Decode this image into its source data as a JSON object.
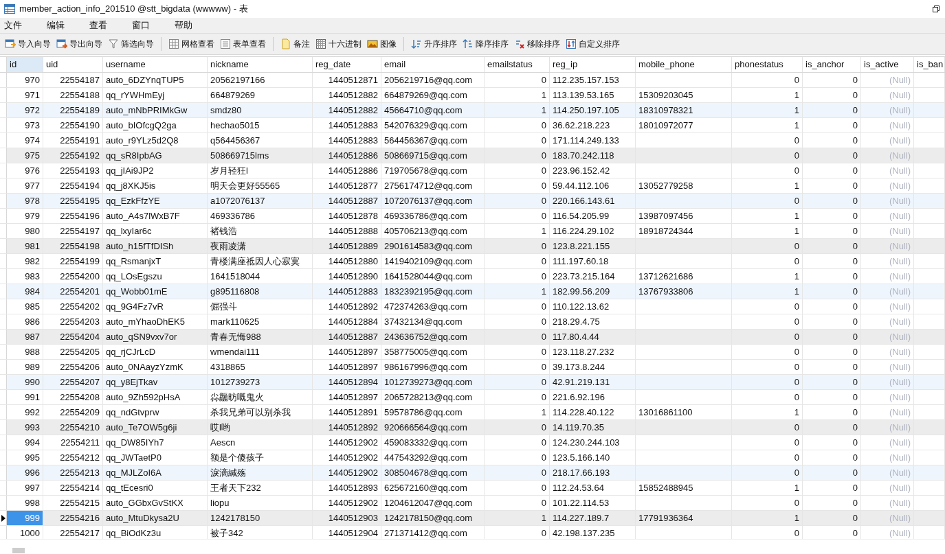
{
  "window": {
    "title": "member_action_info_201510 @stt_bigdata (wwwww) - 表"
  },
  "menu": [
    "文件",
    "编辑",
    "查看",
    "窗口",
    "帮助"
  ],
  "toolbar": [
    [
      "导入向导",
      "导出向导",
      "筛选向导"
    ],
    [
      "网格查看",
      "表单查看"
    ],
    [
      "备注",
      "十六进制",
      "图像"
    ],
    [
      "升序排序",
      "降序排序",
      "移除排序",
      "自定义排序"
    ]
  ],
  "table": {
    "columns": [
      {
        "label": "id",
        "kind": "number",
        "selected": true
      },
      {
        "label": "uid",
        "kind": "number",
        "selected": false
      },
      {
        "label": "username",
        "kind": "text",
        "selected": false
      },
      {
        "label": "nickname",
        "kind": "text",
        "selected": false
      },
      {
        "label": "reg_date",
        "kind": "number",
        "selected": false
      },
      {
        "label": "email",
        "kind": "text",
        "selected": false
      },
      {
        "label": "emailstatus",
        "kind": "number",
        "selected": false
      },
      {
        "label": "reg_ip",
        "kind": "text",
        "selected": false
      },
      {
        "label": "mobile_phone",
        "kind": "text",
        "selected": false
      },
      {
        "label": "phonestatus",
        "kind": "number",
        "selected": false
      },
      {
        "label": "is_anchor",
        "kind": "number",
        "selected": false
      },
      {
        "label": "is_active",
        "kind": "null",
        "selected": false
      },
      {
        "label": "is_ban",
        "selected": false
      }
    ],
    "rows": [
      {
        "selected": false,
        "kind": "plain",
        "cells": [
          "970",
          "22554187",
          "auto_6DZYnqTUP5",
          "20562197166",
          "1440512871",
          "2056219716@qq.com",
          "0",
          "112.235.157.153",
          null,
          "0",
          "0",
          "(Null)"
        ]
      },
      {
        "selected": false,
        "kind": "plain",
        "cells": [
          "971",
          "22554188",
          "qq_rYWHmEyj",
          "664879269",
          "1440512882",
          "664879269@qq.com",
          "1",
          "113.139.53.165",
          "15309203045",
          "1",
          "0",
          "(Null)"
        ]
      },
      {
        "selected": false,
        "kind": "blue",
        "cells": [
          "972",
          "22554189",
          "auto_mNbPRIMkGw",
          "smdz80",
          "1440512882",
          "45664710@qq.com",
          "1",
          "114.250.197.105",
          "18310978321",
          "1",
          "0",
          "(Null)"
        ]
      },
      {
        "selected": false,
        "kind": "plain",
        "cells": [
          "973",
          "22554190",
          "auto_bIOfcgQ2ga",
          "hechao5015",
          "1440512883",
          "542076329@qq.com",
          "0",
          "36.62.218.223",
          "18010972077",
          "1",
          "0",
          "(Null)"
        ]
      },
      {
        "selected": false,
        "kind": "plain",
        "cells": [
          "974",
          "22554191",
          "auto_r9YLz5d2Q8",
          "q564456367",
          "1440512883",
          "564456367@qq.com",
          "0",
          "171.114.249.133",
          null,
          "0",
          "0",
          "(Null)"
        ]
      },
      {
        "selected": false,
        "kind": "gray",
        "cells": [
          "975",
          "22554192",
          "qq_sR8IpbAG",
          "508669715lms",
          "1440512886",
          "508669715@qq.com",
          "0",
          "183.70.242.118",
          null,
          "0",
          "0",
          "(Null)"
        ]
      },
      {
        "selected": false,
        "kind": "plain",
        "cells": [
          "976",
          "22554193",
          "qq_jIAi9JP2",
          "岁月轻狂l",
          "1440512886",
          "719705678@qq.com",
          "0",
          "223.96.152.42",
          null,
          "0",
          "0",
          "(Null)"
        ]
      },
      {
        "selected": false,
        "kind": "plain",
        "cells": [
          "977",
          "22554194",
          "qq_j8XKJ5is",
          "明天会更好55565",
          "1440512877",
          "2756174712@qq.com",
          "0",
          "59.44.112.106",
          "13052779258",
          "1",
          "0",
          "(Null)"
        ]
      },
      {
        "selected": false,
        "kind": "blue",
        "cells": [
          "978",
          "22554195",
          "qq_EzkFfzYE",
          "a1072076137",
          "1440512887",
          "1072076137@qq.com",
          "0",
          "220.166.143.61",
          null,
          "0",
          "0",
          "(Null)"
        ]
      },
      {
        "selected": false,
        "kind": "plain",
        "cells": [
          "979",
          "22554196",
          "auto_A4s7lWxB7F",
          "469336786",
          "1440512878",
          "469336786@qq.com",
          "0",
          "116.54.205.99",
          "13987097456",
          "1",
          "0",
          "(Null)"
        ]
      },
      {
        "selected": false,
        "kind": "plain",
        "cells": [
          "980",
          "22554197",
          "qq_lxyIar6c",
          "褚钱浩",
          "1440512888",
          "405706213@qq.com",
          "1",
          "116.224.29.102",
          "18918724344",
          "1",
          "0",
          "(Null)"
        ]
      },
      {
        "selected": false,
        "kind": "gray",
        "cells": [
          "981",
          "22554198",
          "auto_h15fTfDISh",
          "夜雨凌潇",
          "1440512889",
          "2901614583@qq.com",
          "0",
          "123.8.221.155",
          null,
          "0",
          "0",
          "(Null)"
        ]
      },
      {
        "selected": false,
        "kind": "plain",
        "cells": [
          "982",
          "22554199",
          "qq_RsmanjxT",
          "青楼满座祗因人心寂寞",
          "1440512880",
          "1419402109@qq.com",
          "0",
          "111.197.60.18",
          null,
          "0",
          "0",
          "(Null)"
        ]
      },
      {
        "selected": false,
        "kind": "plain",
        "cells": [
          "983",
          "22554200",
          "qq_LOsEgszu",
          "1641518044",
          "1440512890",
          "1641528044@qq.com",
          "0",
          "223.73.215.164",
          "13712621686",
          "1",
          "0",
          "(Null)"
        ]
      },
      {
        "selected": false,
        "kind": "blue",
        "cells": [
          "984",
          "22554201",
          "qq_Wobb01mE",
          "g895116808",
          "1440512883",
          "1832392195@qq.com",
          "1",
          "182.99.56.209",
          "13767933806",
          "1",
          "0",
          "(Null)"
        ]
      },
      {
        "selected": false,
        "kind": "plain",
        "cells": [
          "985",
          "22554202",
          "qq_9G4Fz7vR",
          "倔强斗",
          "1440512892",
          "472374263@qq.com",
          "0",
          "110.122.13.62",
          null,
          "0",
          "0",
          "(Null)"
        ]
      },
      {
        "selected": false,
        "kind": "plain",
        "cells": [
          "986",
          "22554203",
          "auto_mYhaoDhEK5",
          "mark110625",
          "1440512884",
          "37432134@qq.com",
          "0",
          "218.29.4.75",
          null,
          "0",
          "0",
          "(Null)"
        ]
      },
      {
        "selected": false,
        "kind": "gray",
        "cells": [
          "987",
          "22554204",
          "auto_qSN9vxv7or",
          "青春无悔988",
          "1440512887",
          "243636752@qq.com",
          "0",
          "117.80.4.44",
          null,
          "0",
          "0",
          "(Null)"
        ]
      },
      {
        "selected": false,
        "kind": "plain",
        "cells": [
          "988",
          "22554205",
          "qq_rjCJrLcD",
          "wmendai111",
          "1440512897",
          "358775005@qq.com",
          "0",
          "123.118.27.232",
          null,
          "0",
          "0",
          "(Null)"
        ]
      },
      {
        "selected": false,
        "kind": "plain",
        "cells": [
          "989",
          "22554206",
          "auto_0NAayzYzmK",
          "4318865",
          "1440512897",
          "986167996@qq.com",
          "0",
          "39.173.8.244",
          null,
          "0",
          "0",
          "(Null)"
        ]
      },
      {
        "selected": false,
        "kind": "blue",
        "cells": [
          "990",
          "22554207",
          "qq_y8EjTkav",
          "1012739273",
          "1440512894",
          "1012739273@qq.com",
          "0",
          "42.91.219.131",
          null,
          "0",
          "0",
          "(Null)"
        ]
      },
      {
        "selected": false,
        "kind": "plain",
        "cells": [
          "991",
          "22554208",
          "auto_9Zh592pHsA",
          "尛龘昉嘅鬼火",
          "1440512897",
          "2065728213@qq.com",
          "0",
          "221.6.92.196",
          null,
          "0",
          "0",
          "(Null)"
        ]
      },
      {
        "selected": false,
        "kind": "plain",
        "cells": [
          "992",
          "22554209",
          "qq_ndGtvprw",
          "杀我兄弟可以别杀我",
          "1440512891",
          "59578786@qq.com",
          "1",
          "114.228.40.122",
          "13016861100",
          "1",
          "0",
          "(Null)"
        ]
      },
      {
        "selected": false,
        "kind": "gray",
        "cells": [
          "993",
          "22554210",
          "auto_Te7OW5g6ji",
          "哎l哟",
          "1440512892",
          "920666564@qq.com",
          "0",
          "14.119.70.35",
          null,
          "0",
          "0",
          "(Null)"
        ]
      },
      {
        "selected": false,
        "kind": "plain",
        "cells": [
          "994",
          "22554211",
          "qq_DW85IYh7",
          "Aescn",
          "1440512902",
          "459083332@qq.com",
          "0",
          "124.230.244.103",
          null,
          "0",
          "0",
          "(Null)"
        ]
      },
      {
        "selected": false,
        "kind": "plain",
        "cells": [
          "995",
          "22554212",
          "qq_JWTaetP0",
          "额是个傻孩子",
          "1440512902",
          "447543292@qq.com",
          "0",
          "123.5.166.140",
          null,
          "0",
          "0",
          "(Null)"
        ]
      },
      {
        "selected": false,
        "kind": "blue",
        "cells": [
          "996",
          "22554213",
          "qq_MJLZoI6A",
          "淚滴緘殇",
          "1440512902",
          "308504678@qq.com",
          "0",
          "218.17.66.193",
          null,
          "0",
          "0",
          "(Null)"
        ]
      },
      {
        "selected": false,
        "kind": "plain",
        "cells": [
          "997",
          "22554214",
          "qq_tEcesri0",
          "王者天下232",
          "1440512893",
          "625672160@qq.com",
          "0",
          "112.24.53.64",
          "15852488945",
          "1",
          "0",
          "(Null)"
        ]
      },
      {
        "selected": false,
        "kind": "plain",
        "cells": [
          "998",
          "22554215",
          "auto_GGbxGvStKX",
          "liopu",
          "1440512902",
          "1204612047@qq.com",
          "0",
          "101.22.114.53",
          null,
          "0",
          "0",
          "(Null)"
        ]
      },
      {
        "selected": true,
        "kind": "gray",
        "cells": [
          "999",
          "22554216",
          "auto_MtuDkysa2U",
          "1242178150",
          "1440512903",
          "1242178150@qq.com",
          "1",
          "114.227.189.7",
          "17791936364",
          "1",
          "0",
          "(Null)"
        ]
      },
      {
        "selected": false,
        "kind": "plain",
        "cells": [
          "1000",
          "22554217",
          "qq_BiOdKz3u",
          "被子342",
          "1440512904",
          "271371412@qq.com",
          "0",
          "42.198.137.235",
          null,
          "0",
          "0",
          "(Null)"
        ]
      }
    ]
  }
}
